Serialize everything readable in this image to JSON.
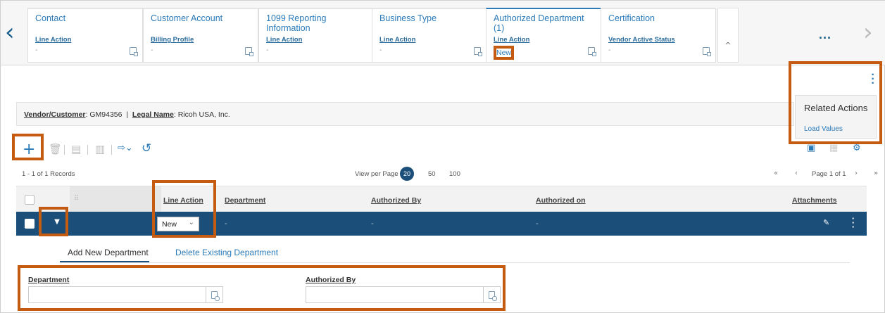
{
  "tabs": [
    {
      "title": "Contact",
      "sub_label": "Line Action",
      "value": "-",
      "active": false
    },
    {
      "title": "Customer Account",
      "sub_label": "Billing Profile",
      "value": "-",
      "active": false
    },
    {
      "title": "1099 Reporting Information",
      "sub_label": "Line Action",
      "value": "-",
      "active": false
    },
    {
      "title": "Business Type",
      "sub_label": "Line Action",
      "value": "-",
      "active": false
    },
    {
      "title": "Authorized Department (1)",
      "sub_label": "Line Action",
      "value": "New",
      "active": true
    },
    {
      "title": "Certification",
      "sub_label": "Vendor Active Status",
      "value": "-",
      "active": false
    }
  ],
  "nav": {
    "prev": "‹",
    "next": "›",
    "more": "...",
    "collapse": "^"
  },
  "related_actions": {
    "title": "Related Actions",
    "items": [
      "Load Values"
    ]
  },
  "vendor": {
    "customer_label": "Vendor/Customer",
    "customer_value": "GM94356",
    "separator": "|",
    "legal_label": "Legal Name",
    "legal_value": "Ricoh USA, Inc."
  },
  "toolbar": {
    "add": "+",
    "undo": "↺"
  },
  "records": {
    "count_text": "1 - 1 of 1 Records",
    "view_per_page": "View per Page -",
    "page_sizes": [
      "20",
      "50",
      "100"
    ],
    "selected_page_size": "20",
    "page_text": "Page 1 of 1"
  },
  "grid": {
    "headers": {
      "line_action": "Line Action",
      "department": "Department",
      "authorized_by": "Authorized By",
      "authorized_on": "Authorized on",
      "attachments": "Attachments"
    },
    "row": {
      "line_action": "New",
      "department": "-",
      "authorized_by": "-",
      "authorized_on": "-"
    }
  },
  "subtabs": {
    "add": "Add New Department",
    "delete": "Delete Existing Department"
  },
  "form": {
    "department_label": "Department",
    "authorized_by_label": "Authorized By"
  },
  "colors": {
    "accent": "#2a7ab8",
    "row_bg": "#1b4e79",
    "highlight": "#c55a11"
  }
}
